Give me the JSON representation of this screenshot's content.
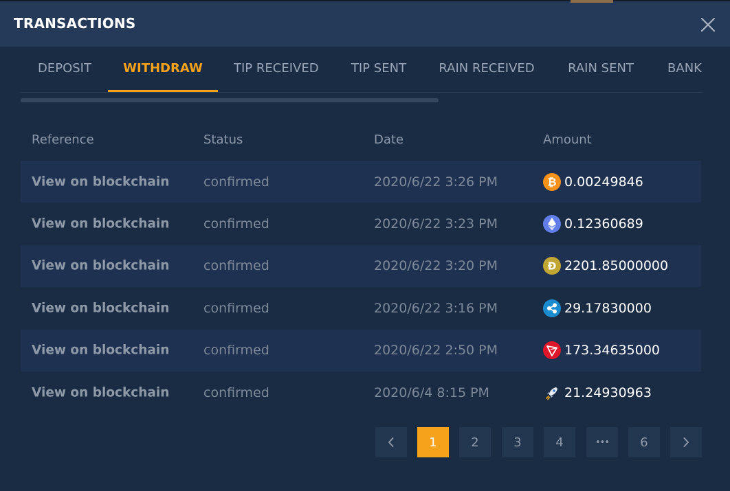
{
  "header": {
    "title": "TRANSACTIONS"
  },
  "tabs": [
    {
      "label": "DEPOSIT",
      "active": false
    },
    {
      "label": "WITHDRAW",
      "active": true
    },
    {
      "label": "TIP RECEIVED",
      "active": false
    },
    {
      "label": "TIP SENT",
      "active": false
    },
    {
      "label": "RAIN RECEIVED",
      "active": false
    },
    {
      "label": "RAIN SENT",
      "active": false
    },
    {
      "label": "BANK",
      "active": false
    }
  ],
  "table": {
    "columns": [
      "Reference",
      "Status",
      "Date",
      "Amount"
    ],
    "rows": [
      {
        "reference": "View on blockchain",
        "status": "confirmed",
        "date": "2020/6/22 3:26 PM",
        "coin_icon": "bitcoin-icon",
        "amount": "0.00249846"
      },
      {
        "reference": "View on blockchain",
        "status": "confirmed",
        "date": "2020/6/22 3:23 PM",
        "coin_icon": "ethereum-icon",
        "amount": "0.12360689"
      },
      {
        "reference": "View on blockchain",
        "status": "confirmed",
        "date": "2020/6/22 3:20 PM",
        "coin_icon": "dogecoin-icon",
        "amount": "2201.85000000"
      },
      {
        "reference": "View on blockchain",
        "status": "confirmed",
        "date": "2020/6/22 3:16 PM",
        "coin_icon": "ripple-icon",
        "amount": "29.17830000"
      },
      {
        "reference": "View on blockchain",
        "status": "confirmed",
        "date": "2020/6/22 2:50 PM",
        "coin_icon": "tron-icon",
        "amount": "173.34635000"
      },
      {
        "reference": "View on blockchain",
        "status": "confirmed",
        "date": "2020/6/4 8:15 PM",
        "coin_icon": "stellar-rocket-icon",
        "amount": "21.24930963"
      }
    ]
  },
  "pagination": {
    "prev_icon": "chevron-left-icon",
    "next_icon": "chevron-right-icon",
    "pages": [
      "1",
      "2",
      "3",
      "4",
      "•••",
      "6"
    ],
    "current": "1"
  },
  "colors": {
    "accent": "#f7a21b",
    "background": "#1a2c44",
    "header": "#253a59",
    "row_alt": "#1e3150"
  }
}
